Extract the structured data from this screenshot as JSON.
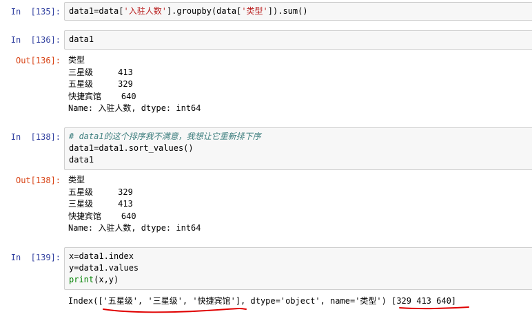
{
  "cells": [
    {
      "id": "c135",
      "in_prompt": "In  [135]:",
      "code": [
        [
          {
            "t": "data1=data["
          },
          {
            "t": "'入驻人数'",
            "c": "str"
          },
          {
            "t": "].groupby(data["
          },
          {
            "t": "'类型'",
            "c": "str"
          },
          {
            "t": "]).sum()"
          }
        ]
      ]
    },
    {
      "id": "c136",
      "in_prompt": "In  [136]:",
      "code": [
        [
          {
            "t": "data1"
          }
        ]
      ],
      "out_prompt": "Out[136]:",
      "output": [
        "类型",
        "三星级     413",
        "五星级     329",
        "快捷宾馆    640",
        "Name: 入驻人数, dtype: int64"
      ]
    },
    {
      "id": "c138",
      "in_prompt": "In  [138]:",
      "code": [
        [
          {
            "t": "# data1的这个排序我不满意，我想让它重新排下序",
            "c": "cmt"
          }
        ],
        [
          {
            "t": "data1=data1.sort_values()"
          }
        ],
        [
          {
            "t": "data1"
          }
        ]
      ],
      "out_prompt": "Out[138]:",
      "output": [
        "类型",
        "五星级     329",
        "三星级     413",
        "快捷宾馆    640",
        "Name: 入驻人数, dtype: int64"
      ]
    },
    {
      "id": "c139",
      "in_prompt": "In  [139]:",
      "code": [
        [
          {
            "t": "x=data1.index"
          }
        ],
        [
          {
            "t": "y=data1.values"
          }
        ],
        [
          {
            "t": "print",
            "c": "kw"
          },
          {
            "t": "(x,y)"
          }
        ]
      ],
      "output": [
        "Index(['五星级', '三星级', '快捷宾馆'], dtype='object', name='类型') [329 413 640]"
      ]
    }
  ],
  "annotation_color": "#e00000"
}
